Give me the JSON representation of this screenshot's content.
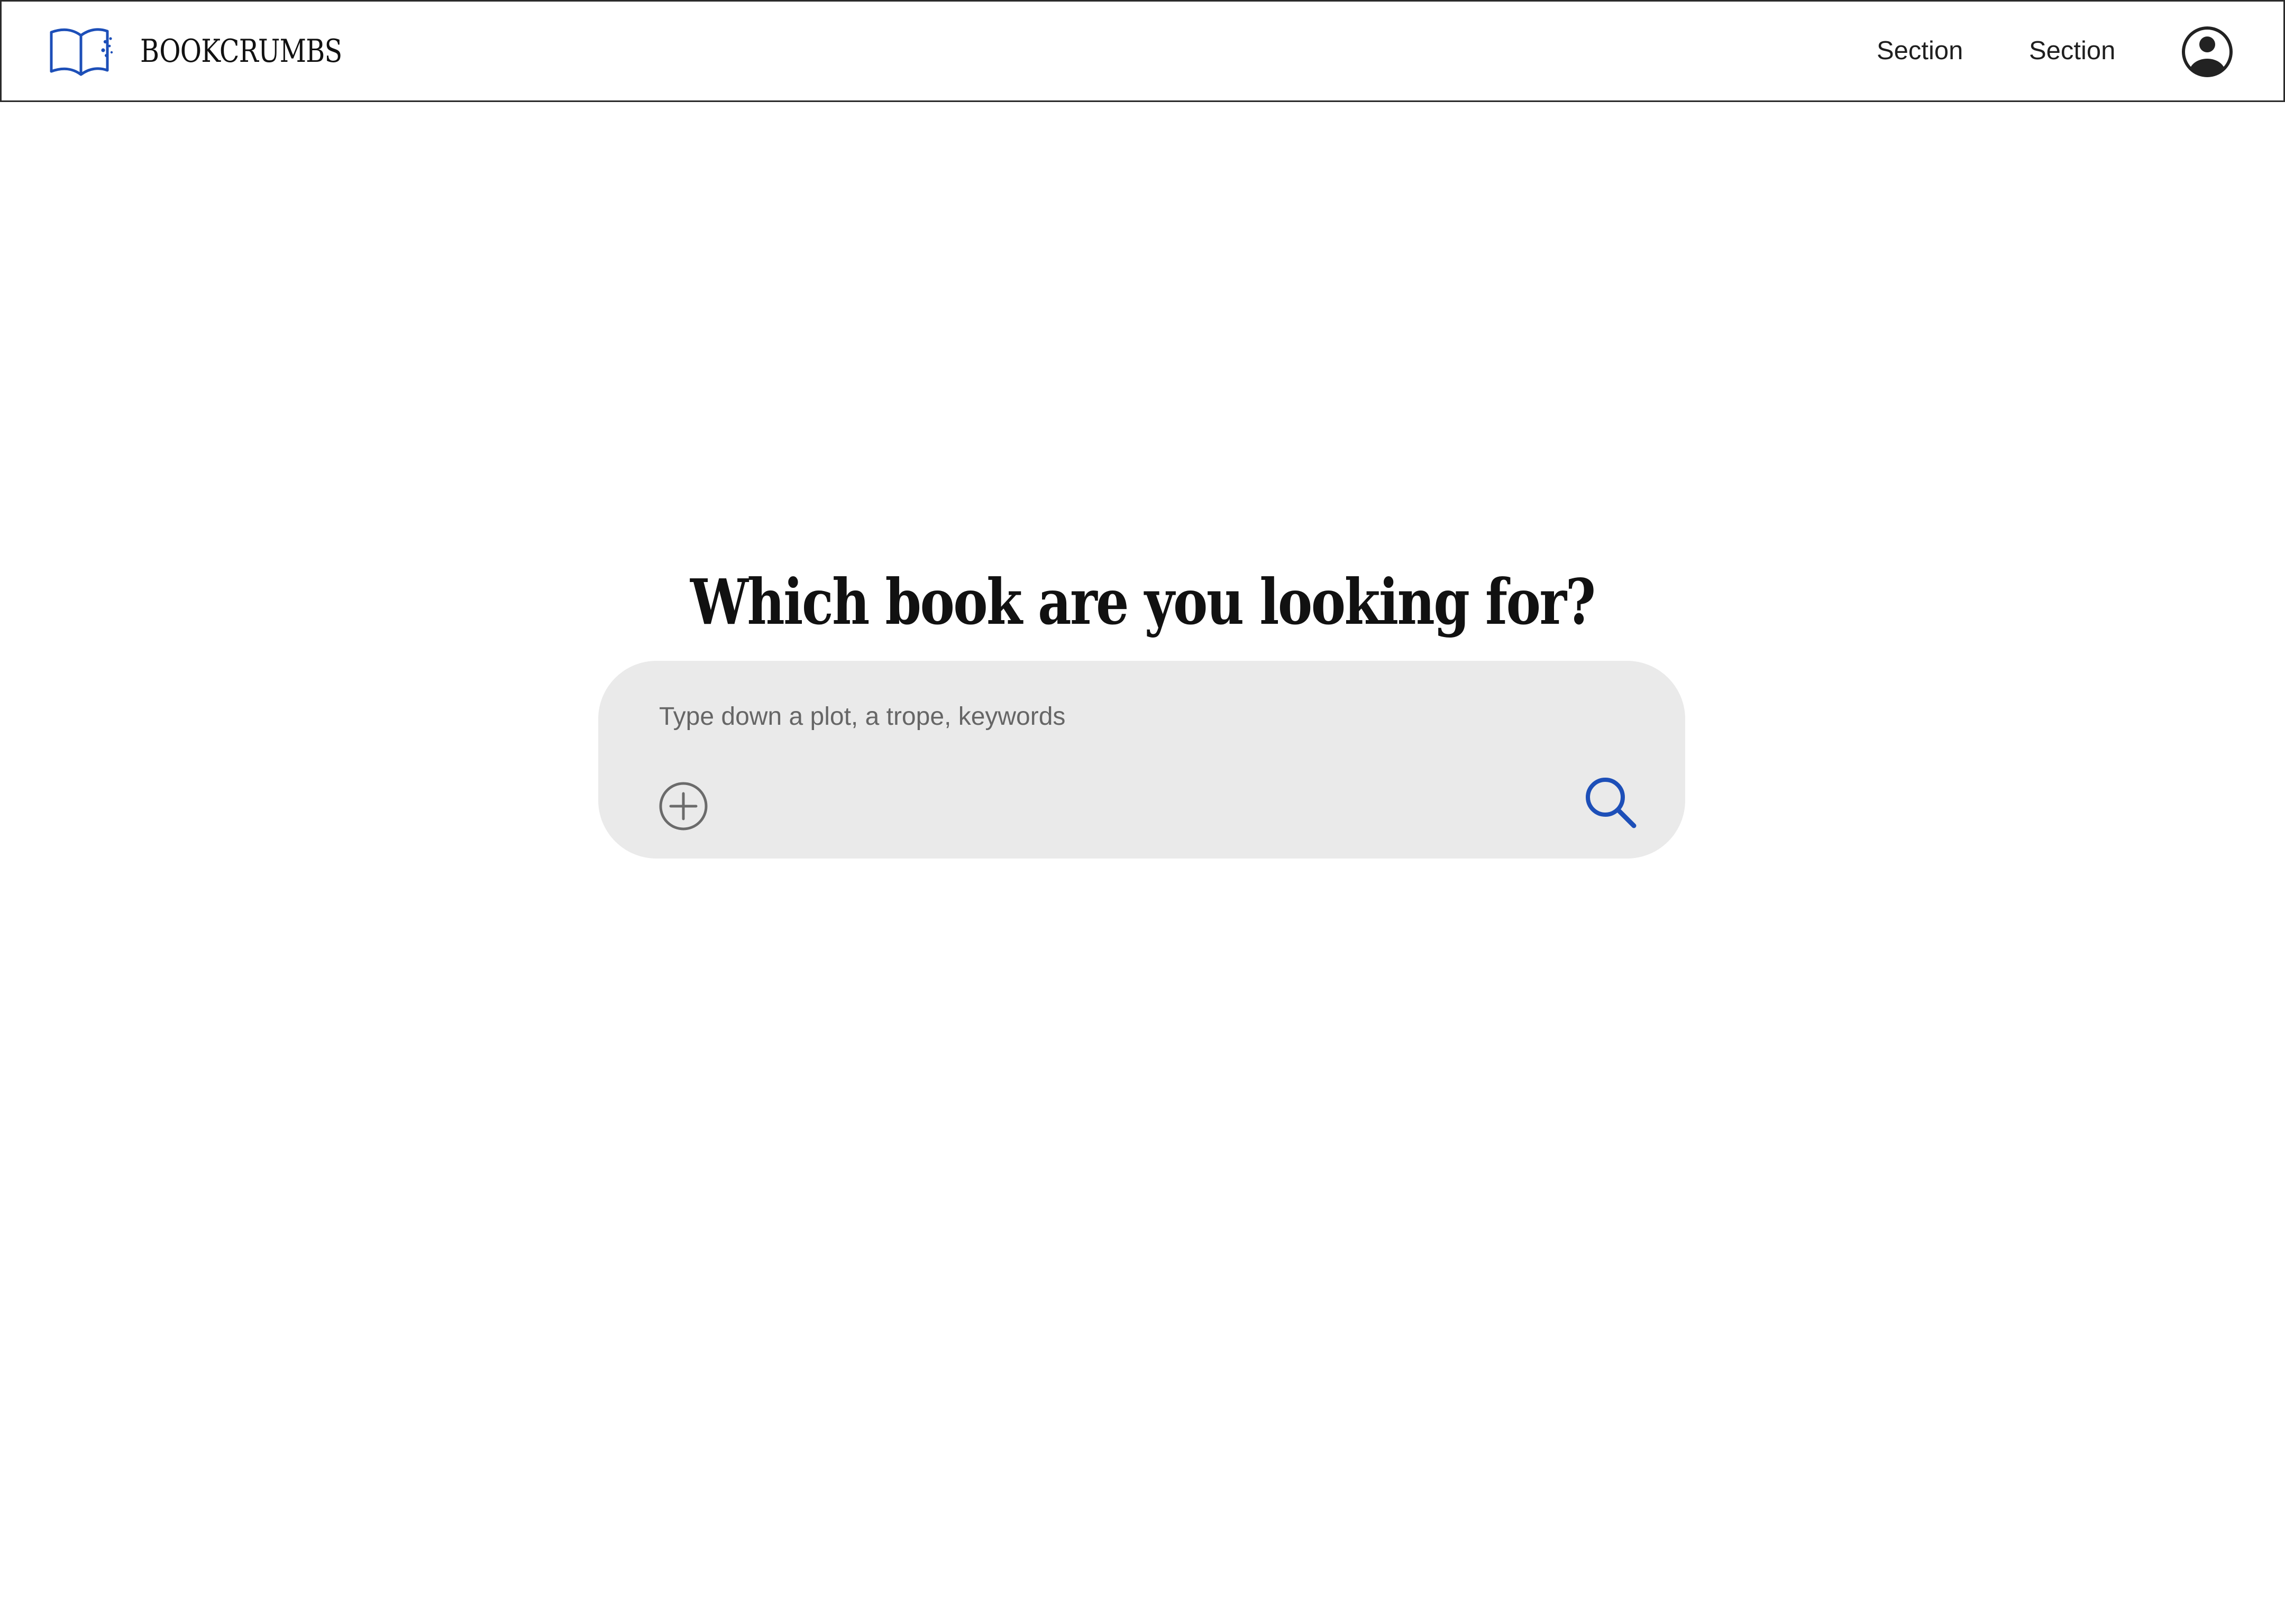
{
  "header": {
    "brand": "BOOKCRUMBS",
    "logo_icon": "open-book-icon",
    "nav": [
      {
        "label": "Section"
      },
      {
        "label": "Section"
      }
    ],
    "account_icon": "user-avatar-icon"
  },
  "main": {
    "headline": "Which book are you looking for?",
    "search": {
      "placeholder": "Type down a plot, a trope, keywords",
      "value": "",
      "add_icon": "plus-circle-icon",
      "submit_icon": "search-icon"
    }
  },
  "colors": {
    "accent": "#1d4fb8",
    "text": "#111111",
    "search_background": "#eaeaea",
    "muted_icon": "#6b6b6b",
    "header_border": "#2b2b2b"
  }
}
